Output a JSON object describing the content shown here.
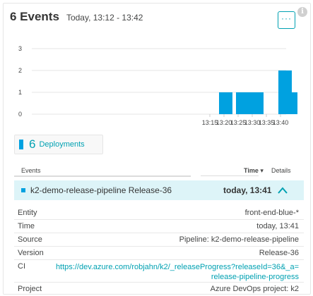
{
  "header": {
    "title": "6 Events",
    "range": "Today, 13:12 - 13:42",
    "more_label": "···",
    "info_label": "i"
  },
  "chart_data": {
    "type": "bar",
    "x": [
      "13:18",
      "13:24",
      "13:27",
      "13:29",
      "13:39",
      "13:41"
    ],
    "values": [
      1,
      1,
      1,
      1,
      2,
      1
    ],
    "x_ticks": [
      "13:15",
      "13:20",
      "13:25",
      "13:30",
      "13:35",
      "13:40"
    ],
    "y_ticks": [
      "0",
      "1",
      "2",
      "3"
    ],
    "ylim": [
      0,
      3
    ],
    "grid": true,
    "bar_color": "#00a1e0"
  },
  "deployments": {
    "count": "6",
    "label": "Deployments"
  },
  "table": {
    "col_events": "Events",
    "col_time": "Time ▾",
    "col_details": "Details"
  },
  "selected_event": {
    "name": "k2-demo-release-pipeline Release-36",
    "time": "today, 13:41"
  },
  "details": [
    {
      "key": "Entity",
      "value": "front-end-blue-*"
    },
    {
      "key": "Time",
      "value": "today, 13:41"
    },
    {
      "key": "Source",
      "value": "Pipeline: k2-demo-release-pipeline"
    },
    {
      "key": "Version",
      "value": "Release-36"
    },
    {
      "key": "CI",
      "value_line1": "https://dev.azure.com/robjahn/k2/_releaseProgress?releaseId=36&_a=",
      "value_line2": "release-pipeline-progress"
    },
    {
      "key": "Project",
      "value": "Azure DevOps project: k2"
    }
  ],
  "colors": {
    "accent": "#00a1b2",
    "bar": "#00a1e0",
    "selected_row": "#ddf4f8"
  }
}
